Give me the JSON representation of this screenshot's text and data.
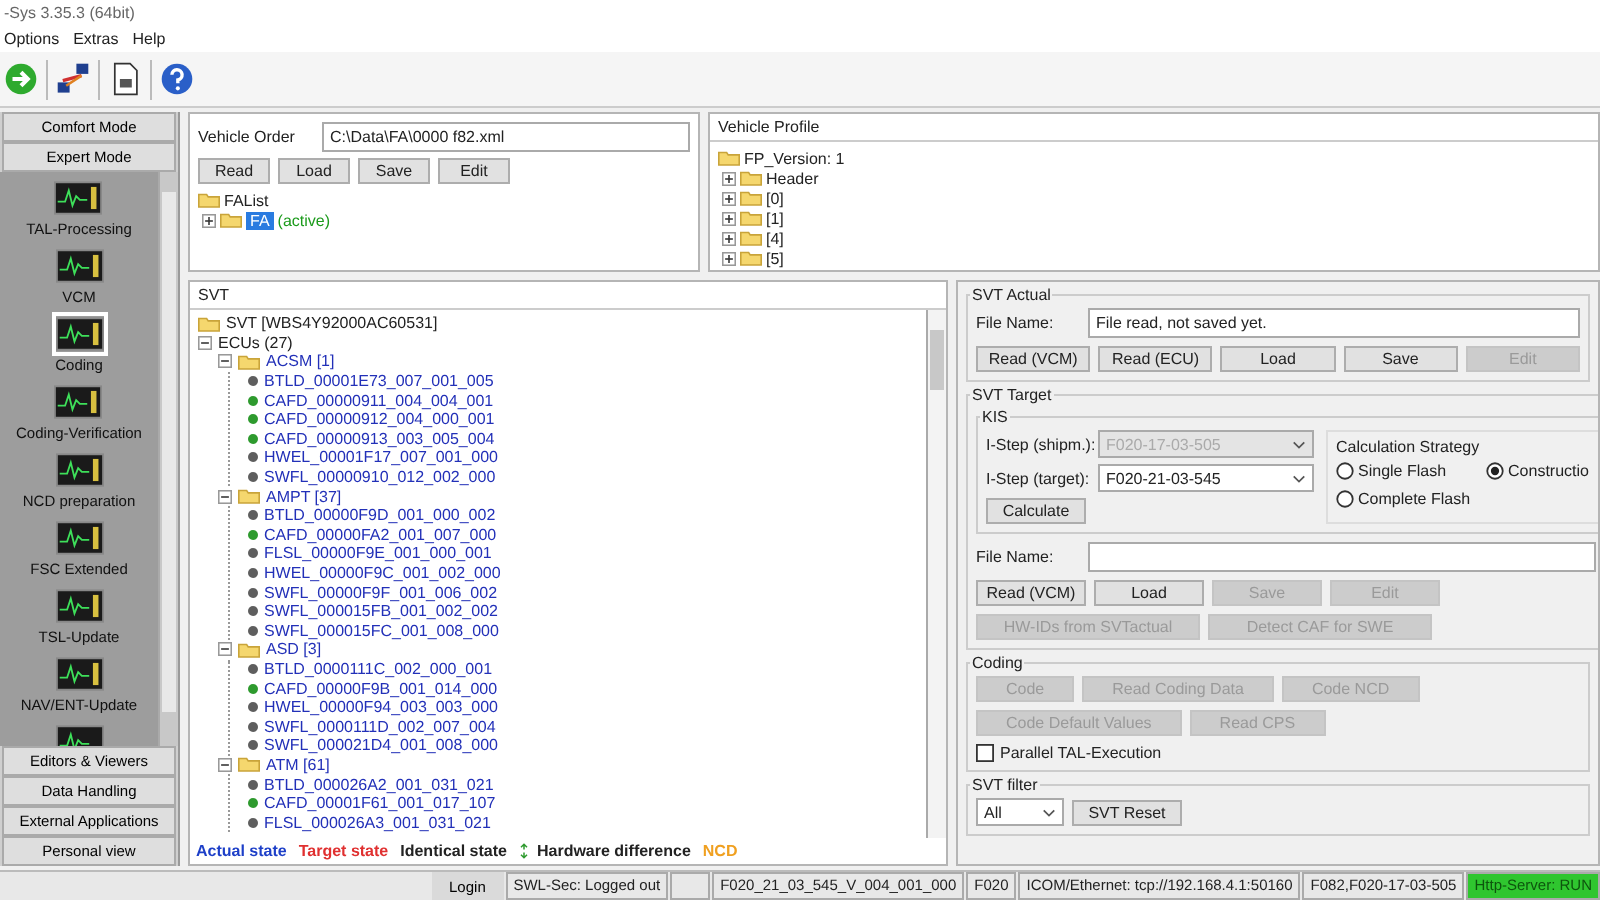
{
  "window": {
    "title": "-Sys 3.35.3  (64bit)"
  },
  "menu": [
    "Options",
    "Extras",
    "Help"
  ],
  "sidebar": {
    "mode_buttons": [
      "Comfort Mode",
      "Expert Mode"
    ],
    "tools": [
      {
        "label": "TAL-Processing",
        "selected": false
      },
      {
        "label": "VCM",
        "selected": false
      },
      {
        "label": "Coding",
        "selected": true
      },
      {
        "label": "Coding-Verification",
        "selected": false
      },
      {
        "label": "NCD preparation",
        "selected": false
      },
      {
        "label": "FSC Extended",
        "selected": false
      },
      {
        "label": "TSL-Update",
        "selected": false
      },
      {
        "label": "NAV/ENT-Update",
        "selected": false
      }
    ],
    "bottom_buttons": [
      "Editors & Viewers",
      "Data Handling",
      "External Applications",
      "Personal view"
    ]
  },
  "vehicle_order": {
    "label": "Vehicle Order",
    "path": "C:\\Data\\FA\\0000 f82.xml",
    "buttons": [
      "Read",
      "Load",
      "Save",
      "Edit"
    ],
    "tree": {
      "label": "FAList",
      "children": [
        {
          "label": "FA",
          "status": "(active)",
          "selected": true,
          "expanded": false
        }
      ]
    }
  },
  "vehicle_profile": {
    "title": "Vehicle Profile",
    "tree": {
      "label": "FP_Version: 1",
      "children": [
        {
          "label": "Header",
          "expanded": false
        },
        {
          "label": "[0]",
          "expanded": false
        },
        {
          "label": "[1]",
          "expanded": false
        },
        {
          "label": "[4]",
          "expanded": false
        },
        {
          "label": "[5]",
          "expanded": false
        }
      ]
    }
  },
  "svt": {
    "title": "SVT",
    "root": "SVT [WBS4Y92000AC60531]",
    "ecus_label": "ECUs (27)",
    "ecus_expanded": true,
    "ecus": [
      {
        "label": "ACSM [1]",
        "expanded": true,
        "children": [
          {
            "label": "BTLD_00001E73_007_001_005",
            "color": "#5e5e5e"
          },
          {
            "label": "CAFD_00000911_004_004_001",
            "color": "#2e9a2e"
          },
          {
            "label": "CAFD_00000912_004_000_001",
            "color": "#2e9a2e"
          },
          {
            "label": "CAFD_00000913_003_005_004",
            "color": "#2e9a2e"
          },
          {
            "label": "HWEL_00001F17_007_001_000",
            "color": "#5e5e5e"
          },
          {
            "label": "SWFL_00000910_012_002_000",
            "color": "#5e5e5e"
          }
        ]
      },
      {
        "label": "AMPT [37]",
        "expanded": true,
        "children": [
          {
            "label": "BTLD_00000F9D_001_000_002",
            "color": "#5e5e5e"
          },
          {
            "label": "CAFD_00000FA2_001_007_000",
            "color": "#2e9a2e"
          },
          {
            "label": "FLSL_00000F9E_001_000_001",
            "color": "#5e5e5e"
          },
          {
            "label": "HWEL_00000F9C_001_002_000",
            "color": "#5e5e5e"
          },
          {
            "label": "SWFL_00000F9F_001_006_002",
            "color": "#5e5e5e"
          },
          {
            "label": "SWFL_000015FB_001_002_002",
            "color": "#5e5e5e"
          },
          {
            "label": "SWFL_000015FC_001_008_000",
            "color": "#5e5e5e"
          }
        ]
      },
      {
        "label": "ASD [3]",
        "expanded": true,
        "children": [
          {
            "label": "BTLD_0000111C_002_000_001",
            "color": "#5e5e5e"
          },
          {
            "label": "CAFD_00000F9B_001_014_000",
            "color": "#2e9a2e"
          },
          {
            "label": "HWEL_00000F94_003_003_000",
            "color": "#5e5e5e"
          },
          {
            "label": "SWFL_0000111D_002_007_004",
            "color": "#5e5e5e"
          },
          {
            "label": "SWFL_000021D4_001_008_000",
            "color": "#5e5e5e"
          }
        ]
      },
      {
        "label": "ATM [61]",
        "expanded": true,
        "children": [
          {
            "label": "BTLD_000026A2_001_031_021",
            "color": "#5e5e5e"
          },
          {
            "label": "CAFD_00001F61_001_017_107",
            "color": "#2e9a2e"
          },
          {
            "label": "FLSL_000026A3_001_031_021",
            "color": "#5e5e5e"
          }
        ]
      }
    ],
    "legend": [
      {
        "label": "Actual state",
        "color": "#1d3fc8",
        "kind": "text"
      },
      {
        "label": "Target state",
        "color": "#e03030",
        "kind": "text"
      },
      {
        "label": "Identical state",
        "color": "#222222",
        "kind": "text"
      },
      {
        "label": "Hardware difference",
        "color": "#222222",
        "kind": "hardware"
      },
      {
        "label": "NCD",
        "color": "#f0a020",
        "kind": "text"
      }
    ]
  },
  "svt_actual": {
    "title": "SVT Actual",
    "file_label": "File Name:",
    "file_value": "File read, not saved yet.",
    "buttons": [
      {
        "label": "Read (VCM)",
        "disabled": false
      },
      {
        "label": "Read (ECU)",
        "disabled": false
      },
      {
        "label": "Load",
        "disabled": false
      },
      {
        "label": "Save",
        "disabled": false
      },
      {
        "label": "Edit",
        "disabled": true
      }
    ]
  },
  "svt_target": {
    "title": "SVT Target",
    "kis": {
      "title": "KIS",
      "fields": [
        {
          "label": "I-Step (shipm.):",
          "value": "F020-17-03-505",
          "disabled": true
        },
        {
          "label": "I-Step (target):",
          "value": "F020-21-03-545",
          "disabled": false
        }
      ],
      "calculate": "Calculate",
      "strategy": {
        "title": "Calculation Strategy",
        "options": [
          {
            "label": "Single Flash",
            "selected": false
          },
          {
            "label": "Constructio",
            "selected": true
          },
          {
            "label": "Complete Flash",
            "selected": false
          }
        ]
      }
    },
    "file_label": "File Name:",
    "buttons": [
      {
        "label": "Read (VCM)",
        "disabled": false
      },
      {
        "label": "Load",
        "disabled": false
      },
      {
        "label": "Save",
        "disabled": true
      },
      {
        "label": "Edit",
        "disabled": true
      }
    ],
    "buttons_row2": [
      {
        "label": "HW-IDs from SVTactual",
        "disabled": true
      },
      {
        "label": "Detect CAF for SWE",
        "disabled": true
      }
    ]
  },
  "coding": {
    "title": "Coding",
    "rows": [
      [
        {
          "label": "Code",
          "disabled": true
        },
        {
          "label": "Read Coding Data",
          "disabled": true
        },
        {
          "label": "Code NCD",
          "disabled": true
        }
      ],
      [
        {
          "label": "Code Default Values",
          "disabled": true
        },
        {
          "label": "Read CPS",
          "disabled": true
        }
      ]
    ],
    "parallel": {
      "label": "Parallel TAL-Execution",
      "checked": false
    }
  },
  "svt_filter": {
    "title": "SVT filter",
    "value": "All",
    "reset": "SVT Reset"
  },
  "status_bar": {
    "login": "Login",
    "cells": [
      {
        "text": "SWL-Sec: Logged out",
        "kind": "plain"
      },
      {
        "text": "F020_21_03_545_V_004_001_000",
        "kind": "plain"
      },
      {
        "text": "F020",
        "kind": "plain"
      },
      {
        "text": "ICOM/Ethernet: tcp://192.168.4.1:50160",
        "kind": "plain"
      },
      {
        "text": "F082,F020-17-03-505",
        "kind": "plain"
      },
      {
        "text": "Http-Server: RUN",
        "kind": "ok"
      }
    ]
  }
}
